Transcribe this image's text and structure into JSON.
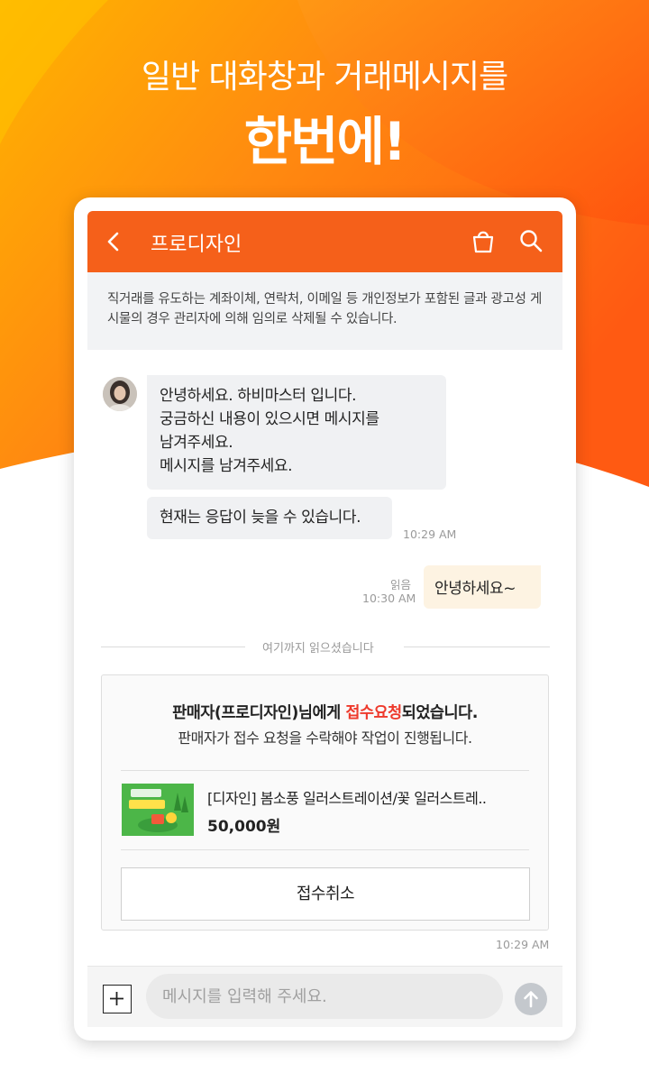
{
  "hero": {
    "line1": "일반 대화창과 거래메시지를",
    "line2": "한번에!"
  },
  "colors": {
    "brand_orange": "#f5601a",
    "accent_red": "#ee3a2c",
    "bubble_in": "#f0f1f3",
    "bubble_out": "#fdf3e2"
  },
  "appbar": {
    "title": "프로디자인",
    "back_icon": "chevron-left-icon",
    "bag_icon": "shopping-bag-icon",
    "search_icon": "search-icon"
  },
  "notice": {
    "text": "직거래를 유도하는 계좌이체, 연락처, 이메일 등 개인정보가 포함된 글과 광고성 게시물의 경우 관리자에 의해 임의로 삭제될 수 있습니다."
  },
  "messages": {
    "incoming_1": {
      "line1": "안녕하세요. 하비마스터 입니다.",
      "line2": "궁금하신 내용이 있으시면 메시지를",
      "line3": "남겨주세요.",
      "line4": "메시지를 남겨주세요."
    },
    "incoming_2": "현재는 응답이 늦을 수 있습니다.",
    "incoming_time": "10:29 AM",
    "outgoing": "안녕하세요~",
    "outgoing_read": "읽음",
    "outgoing_time": "10:30 AM"
  },
  "read_divider": "여기까지 읽으셨습니다",
  "order_card": {
    "title_prefix": "판매자(프로디자인)님에게 ",
    "title_accent": "접수요청",
    "title_suffix": "되었습니다.",
    "subtitle": "판매자가 접수 요청을 수락해야 작업이 진행됩니다.",
    "product_name": "[디자인] 봄소풍 일러스트레이션/꽃 일러스트레..",
    "product_price": "50,000원",
    "cancel_label": "접수취소",
    "time": "10:29 AM"
  },
  "input_bar": {
    "placeholder": "메시지를 입력해 주세요.",
    "add_icon": "plus-icon",
    "send_icon": "send-arrow-icon"
  }
}
